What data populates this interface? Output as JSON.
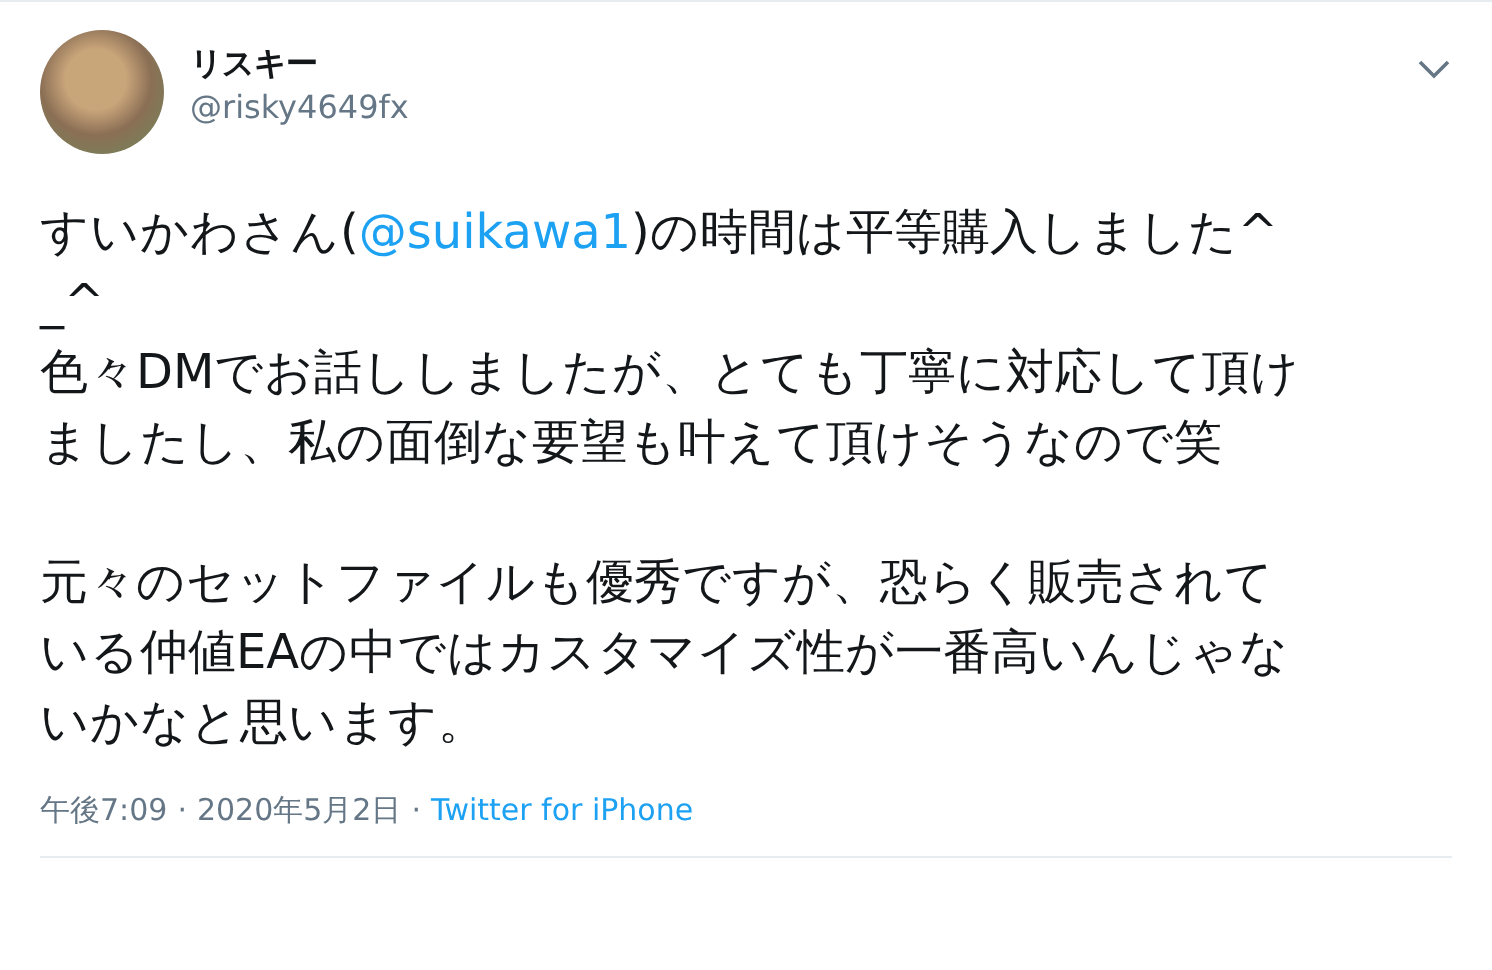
{
  "author": {
    "name": "リスキー",
    "handle": "@risky4649fx"
  },
  "paragraphs": [
    {
      "segments": [
        {
          "kind": "text",
          "text": "すいかわさん("
        },
        {
          "kind": "mention",
          "text": "@suikawa1"
        },
        {
          "kind": "text",
          "text": ")の時間は平等購入しました^_^\n色々DMでお話ししましたが、とても丁寧に対応して頂けましたし、私の面倒な要望も叶えて頂けそうなので笑"
        }
      ]
    },
    {
      "segments": [
        {
          "kind": "text",
          "text": "元々のセットファイルも優秀ですが、恐らく販売されている仲値EAの中ではカスタマイズ性が一番高いんじゃないかなと思います。"
        }
      ]
    }
  ],
  "meta": {
    "time": "午後7:09",
    "separator_1": "·",
    "date": "2020年5月2日",
    "separator_2": "·",
    "source": "Twitter for iPhone"
  }
}
